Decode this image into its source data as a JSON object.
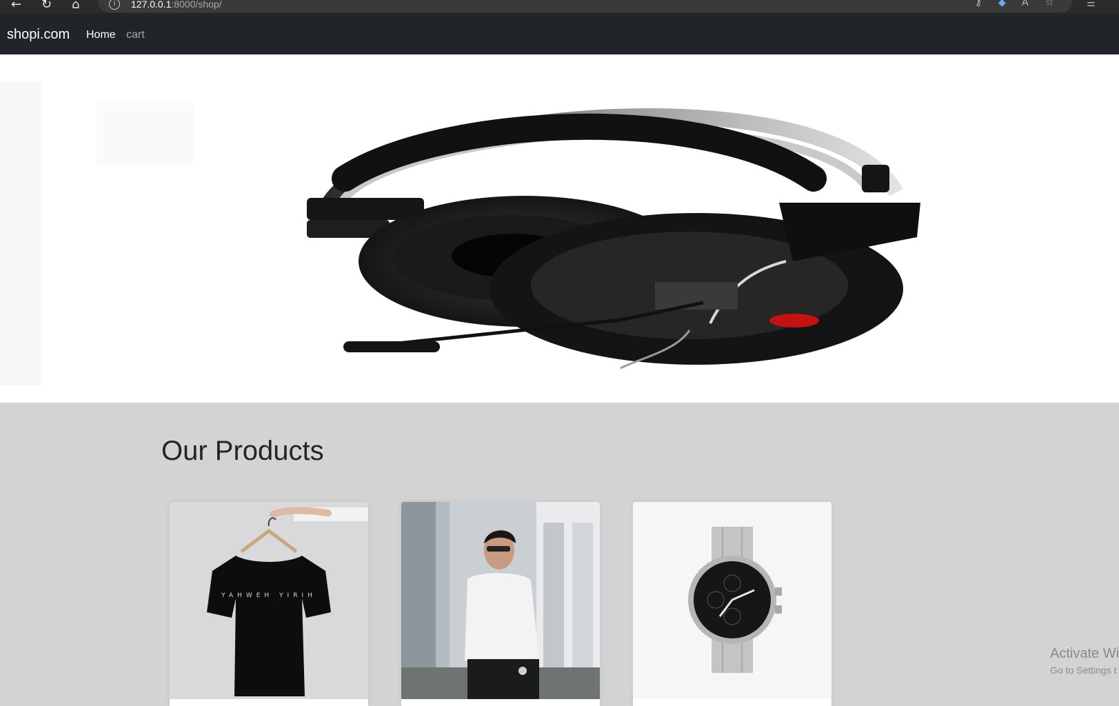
{
  "browser": {
    "url_host": "127.0.0.1",
    "url_rest": ":8000/shop/",
    "icons": [
      "back-arrow-icon",
      "reload-icon",
      "home-icon",
      "site-info-icon",
      "key-icon",
      "extension-icon",
      "read-aloud-icon",
      "favorites-icon",
      "collections-icon"
    ]
  },
  "navbar": {
    "brand": "shopi.com",
    "links": [
      {
        "label": "Home",
        "active": true
      },
      {
        "label": "cart",
        "active": false
      }
    ],
    "bg_color": "#212529"
  },
  "hero": {
    "image": "headphones-image"
  },
  "products": {
    "title": "Our Products",
    "items": [
      {
        "image": "black-tshirt-image"
      },
      {
        "image": "man-white-shirt-image"
      },
      {
        "image": "silver-watch-image"
      }
    ]
  },
  "watermark": {
    "title": "Activate Wi",
    "subtitle": "Go to Settings t"
  },
  "colors": {
    "page_bg": "#d3d3d3",
    "hero_bg": "#ffffff",
    "text_dark": "#212529"
  }
}
